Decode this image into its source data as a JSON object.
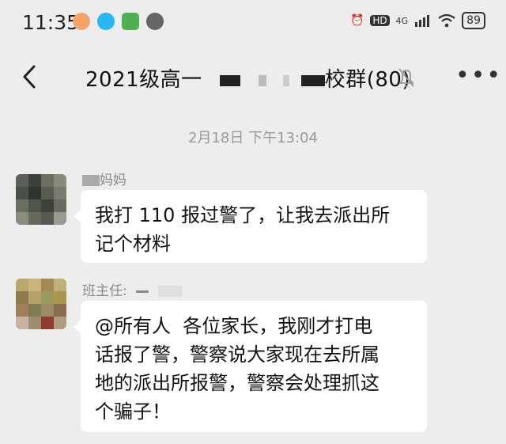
{
  "status_bar": {
    "time": "11:35",
    "battery": "89",
    "network": "4G",
    "hd": "HD",
    "icons": [
      "taobao-icon",
      "qq-icon",
      "tv-app-icon",
      "compass-icon",
      "alarm-icon",
      "signal-icon",
      "wifi-icon"
    ]
  },
  "header": {
    "title_prefix": "2021级高一",
    "title_suffix": "校群(80)",
    "back_icon": "chevron-left-icon",
    "mute_icon": "bell-muted-icon",
    "more_icon": "more-dots-icon"
  },
  "chat": {
    "timestamp": "2月18日 下午13:04",
    "messages": [
      {
        "sender": "妈妈",
        "text": "我打 110 报过警了，让我去派出所\n记个材料"
      },
      {
        "sender": "班主任:",
        "text": "@所有人  各位家长，我刚才打电\n话报了警，警察说大家现在去所属\n地的派出所报警，警察会处理抓这\n个骗子！"
      }
    ]
  },
  "colors": {
    "background": "#ededed",
    "bubble": "#ffffff",
    "timestamp": "#999999"
  }
}
